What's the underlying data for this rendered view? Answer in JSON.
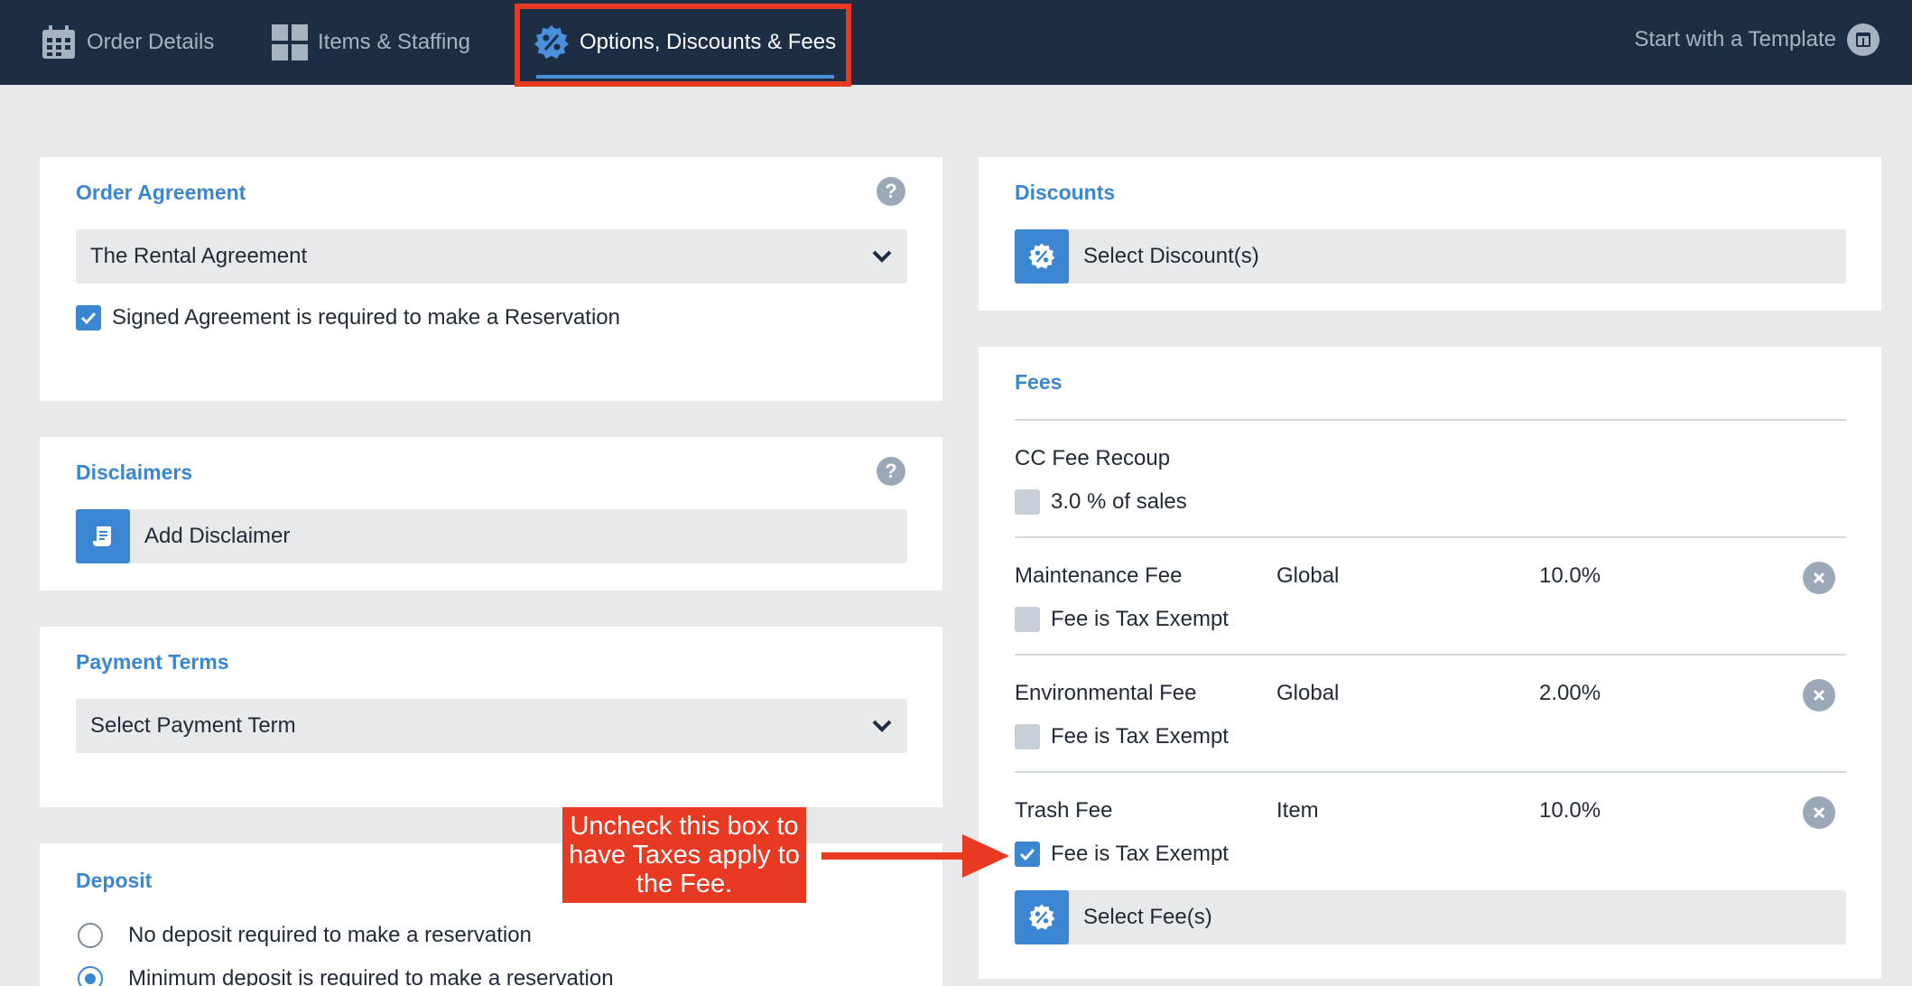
{
  "nav": {
    "tabs": [
      {
        "label": "Order Details",
        "icon": "calendar-icon"
      },
      {
        "label": "Items & Staffing",
        "icon": "grid-icon"
      },
      {
        "label": "Options, Discounts & Fees",
        "icon": "percent-badge-icon",
        "active": true
      }
    ],
    "template_label": "Start with a Template",
    "template_icon": "template-icon"
  },
  "order_agreement": {
    "title": "Order Agreement",
    "selected": "The Rental Agreement",
    "signed_required_label": "Signed Agreement is required to make a Reservation",
    "signed_required": true
  },
  "disclaimers": {
    "title": "Disclaimers",
    "add_label": "Add Disclaimer"
  },
  "payment_terms": {
    "title": "Payment Terms",
    "placeholder": "Select Payment Term"
  },
  "deposit": {
    "title": "Deposit",
    "options": [
      {
        "label": "No deposit required to make a reservation",
        "selected": false
      },
      {
        "label": "Minimum deposit is required to make a reservation",
        "selected": true
      }
    ]
  },
  "discounts": {
    "title": "Discounts",
    "select_label": "Select Discount(s)"
  },
  "fees": {
    "title": "Fees",
    "cc_fee": {
      "name": "CC Fee Recoup",
      "checkbox_label": "3.0 % of sales",
      "checked": false
    },
    "items": [
      {
        "name": "Maintenance Fee",
        "scope": "Global",
        "amount": "10.0%",
        "tax_exempt_label": "Fee is Tax Exempt",
        "tax_exempt": false
      },
      {
        "name": "Environmental Fee",
        "scope": "Global",
        "amount": "2.00%",
        "tax_exempt_label": "Fee is Tax Exempt",
        "tax_exempt": false
      },
      {
        "name": "Trash Fee",
        "scope": "Item",
        "amount": "10.0%",
        "tax_exempt_label": "Fee is Tax Exempt",
        "tax_exempt": true
      }
    ],
    "select_label": "Select Fee(s)"
  },
  "annotation": {
    "text": "Uncheck this box to have Taxes apply to the Fee.",
    "color": "#e83a23"
  },
  "colors": {
    "nav_bg": "#1d2d44",
    "accent": "#3b86d2",
    "highlight": "#e83a23"
  }
}
